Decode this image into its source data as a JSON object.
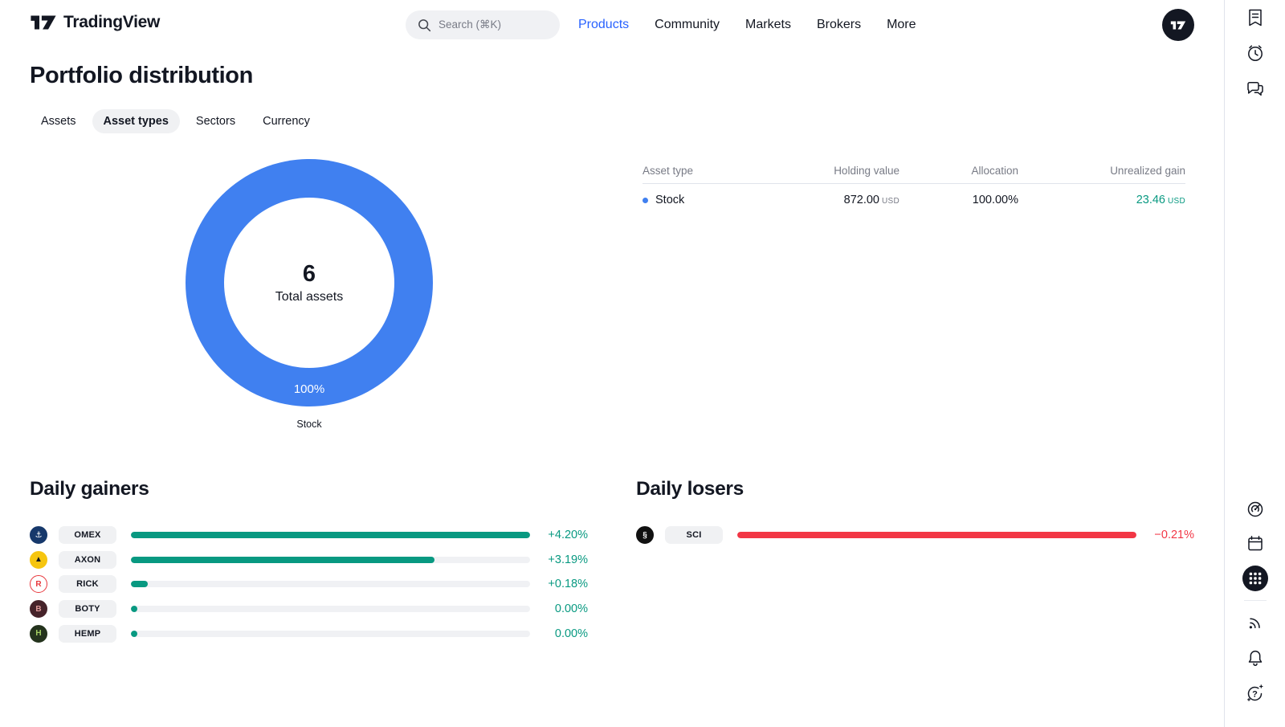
{
  "colors": {
    "accent_blue": "#2962FF",
    "chart_blue": "#4080F0",
    "green": "#089981",
    "red": "#F23645",
    "text_primary": "#131722",
    "text_muted": "#787B86",
    "divider": "#E0E3EB"
  },
  "nav": {
    "brand": "TradingView",
    "search_placeholder": "Search (⌘K)",
    "links": [
      {
        "label": "Products",
        "active": true
      },
      {
        "label": "Community",
        "active": false
      },
      {
        "label": "Markets",
        "active": false
      },
      {
        "label": "Brokers",
        "active": false
      },
      {
        "label": "More",
        "active": false
      }
    ]
  },
  "sidebar_icons": [
    "watchlist",
    "alerts-clock",
    "chat",
    "screener-radar",
    "calendar",
    "apps-grid",
    "news-feed",
    "notifications-bell",
    "help"
  ],
  "page_title": "Portfolio distribution",
  "tabs": [
    {
      "label": "Assets",
      "active": false
    },
    {
      "label": "Asset types",
      "active": true
    },
    {
      "label": "Sectors",
      "active": false
    },
    {
      "label": "Currency",
      "active": false
    }
  ],
  "donut": {
    "center_value": "6",
    "center_label": "Total assets",
    "slice_display": "100%",
    "slice_label": "Stock",
    "slice_color": "#4080F0"
  },
  "holdings_table": {
    "headers": [
      "Asset type",
      "Holding value",
      "Allocation",
      "Unrealized gain"
    ],
    "rows": [
      {
        "asset": "Stock",
        "dot_color": "#4080F0",
        "holding_value": "872.00",
        "holding_currency": "USD",
        "allocation": "100.00%",
        "gain": "23.46",
        "gain_currency": "USD"
      }
    ]
  },
  "gainers": {
    "title": "Daily gainers",
    "items": [
      {
        "ticker": "OMEX",
        "change": "+4.20%",
        "fill_pct": 100,
        "logo": {
          "glyph": "⚓",
          "bg": "#16386B",
          "fg": "#FFFFFF",
          "bd": "#16386B"
        }
      },
      {
        "ticker": "AXON",
        "change": "+3.19%",
        "fill_pct": 76,
        "logo": {
          "glyph": "▲",
          "bg": "#F6C50F",
          "fg": "#131722",
          "bd": "#F6C50F"
        }
      },
      {
        "ticker": "RICK",
        "change": "+0.18%",
        "fill_pct": 4.3,
        "logo": {
          "glyph": "R",
          "bg": "#FFFFFF",
          "fg": "#E8373C",
          "bd": "#E8373C"
        }
      },
      {
        "ticker": "BOTY",
        "change": "0.00%",
        "fill_pct": 0,
        "logo": {
          "glyph": "B",
          "bg": "#46232A",
          "fg": "#E09A9A",
          "bd": "#46232A"
        }
      },
      {
        "ticker": "HEMP",
        "change": "0.00%",
        "fill_pct": 0,
        "logo": {
          "glyph": "H",
          "bg": "#24331D",
          "fg": "#A5D063",
          "bd": "#24331D"
        }
      }
    ]
  },
  "losers": {
    "title": "Daily losers",
    "items": [
      {
        "ticker": "SCI",
        "change": "−0.21%",
        "fill_pct": 100,
        "logo": {
          "glyph": "§",
          "bg": "#111111",
          "fg": "#FFFFFF",
          "bd": "#111111"
        }
      }
    ]
  },
  "chart_data": [
    {
      "type": "pie",
      "title": "Portfolio distribution — Asset types",
      "slices": [
        {
          "label": "Stock",
          "value": 100,
          "display": "100%",
          "color": "#4080F0"
        }
      ],
      "center_value": 6,
      "center_label": "Total assets",
      "legend_position": "none"
    },
    {
      "type": "bar",
      "title": "Daily gainers",
      "categories": [
        "OMEX",
        "AXON",
        "RICK",
        "BOTY",
        "HEMP"
      ],
      "values": [
        4.2,
        3.19,
        0.18,
        0.0,
        0.0
      ],
      "unit": "percent",
      "bar_color": "#089981"
    },
    {
      "type": "bar",
      "title": "Daily losers",
      "categories": [
        "SCI"
      ],
      "values": [
        -0.21
      ],
      "unit": "percent",
      "bar_color": "#F23645"
    }
  ]
}
